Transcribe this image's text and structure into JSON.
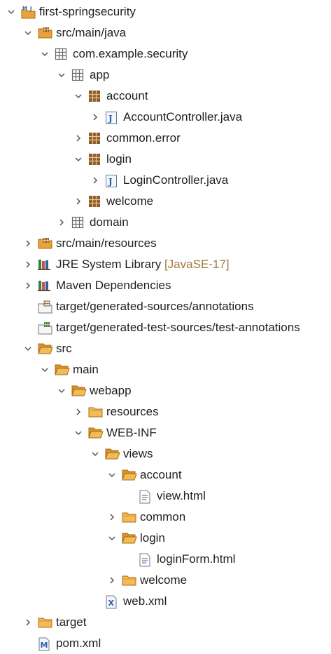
{
  "tree": {
    "project": "first-springsecurity",
    "src_main_java": "src/main/java",
    "pkg_security": "com.example.security",
    "pkg_app": "app",
    "pkg_account": "account",
    "account_controller": "AccountController.java",
    "pkg_common_error": "common.error",
    "pkg_login": "login",
    "login_controller": "LoginController.java",
    "pkg_welcome": "welcome",
    "pkg_domain": "domain",
    "src_main_resources": "src/main/resources",
    "jre_library": "JRE System Library",
    "jre_decoration": "[JavaSE-17]",
    "maven_dependencies": "Maven Dependencies",
    "generated_sources": "target/generated-sources/annotations",
    "generated_test_sources": "target/generated-test-sources/test-annotations",
    "src": "src",
    "main": "main",
    "webapp": "webapp",
    "resources": "resources",
    "web_inf": "WEB-INF",
    "views": "views",
    "views_account": "account",
    "view_html": "view.html",
    "views_common": "common",
    "views_login": "login",
    "login_form_html": "loginForm.html",
    "views_welcome": "welcome",
    "web_xml": "web.xml",
    "target": "target",
    "pom_xml": "pom.xml"
  },
  "colors": {
    "folder": "#e8a33a",
    "package": "#8b5a2b",
    "java_file": "#2f5fa8",
    "decoration_text": "#a07a3a"
  }
}
